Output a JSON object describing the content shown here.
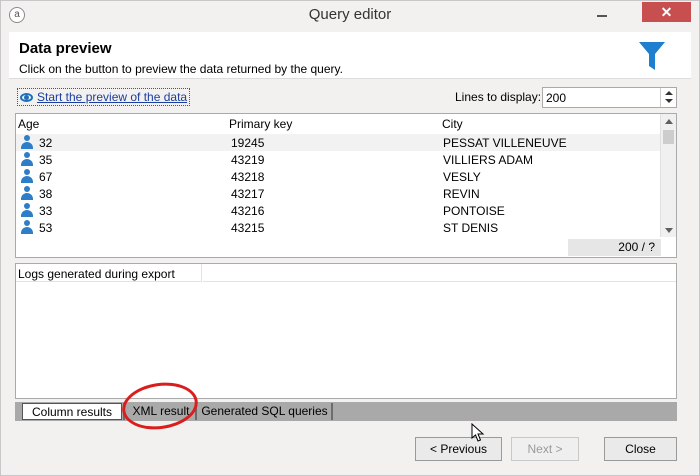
{
  "window": {
    "title": "Query editor",
    "close_label": "✕"
  },
  "header": {
    "title": "Data preview",
    "subtitle": "Click on the button to preview the data returned by the query."
  },
  "preview": {
    "link_label": "Start the preview of the data",
    "lines_label": "Lines to display:",
    "lines_value": "200"
  },
  "grid": {
    "columns": [
      "Age",
      "Primary key",
      "City"
    ],
    "rows": [
      {
        "age": "32",
        "key": "19245",
        "city": "PESSAT VILLENEUVE"
      },
      {
        "age": "35",
        "key": "43219",
        "city": "VILLIERS ADAM"
      },
      {
        "age": "67",
        "key": "43218",
        "city": "VESLY"
      },
      {
        "age": "38",
        "key": "43217",
        "city": "REVIN"
      },
      {
        "age": "33",
        "key": "43216",
        "city": "PONTOISE"
      },
      {
        "age": "53",
        "key": "43215",
        "city": "ST DENIS"
      }
    ],
    "count": "200 / ?"
  },
  "logs": {
    "header": "Logs generated during export"
  },
  "tabs": [
    "Column results",
    "XML result",
    "Generated SQL queries"
  ],
  "buttons": {
    "previous": "< Previous",
    "next": "Next >",
    "close": "Close"
  },
  "colors": {
    "accent": "#1e6fb8",
    "annotation": "#d91e1e",
    "close_red": "#c74f50"
  }
}
